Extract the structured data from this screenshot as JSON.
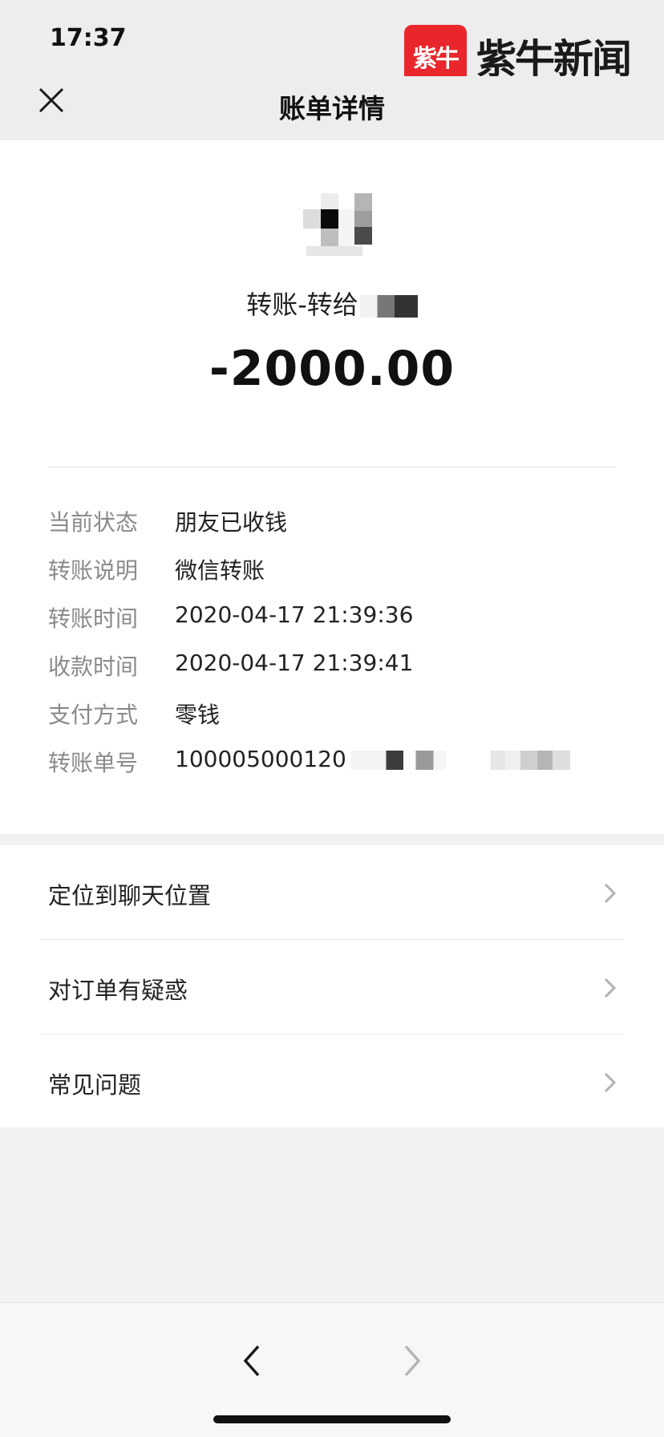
{
  "status_bar": {
    "time": "17:37"
  },
  "brand": {
    "logo_text": "紫牛",
    "name": "紫牛新闻"
  },
  "nav": {
    "title": "账单详情"
  },
  "transaction": {
    "title_prefix": "转账-转给",
    "amount": "-2000.00"
  },
  "details": [
    {
      "label": "当前状态",
      "value": "朋友已收钱"
    },
    {
      "label": "转账说明",
      "value": "微信转账"
    },
    {
      "label": "转账时间",
      "value": "2020-04-17 21:39:36"
    },
    {
      "label": "收款时间",
      "value": "2020-04-17 21:39:41"
    },
    {
      "label": "支付方式",
      "value": "零钱"
    },
    {
      "label": "转账单号",
      "value": "100005000120"
    }
  ],
  "actions": [
    {
      "label": "定位到聊天位置"
    },
    {
      "label": "对订单有疑惑"
    },
    {
      "label": "常见问题"
    }
  ],
  "colors": {
    "brand_red": "#e8262b",
    "label_gray": "#8a8a8a",
    "background": "#f2f2f2"
  }
}
